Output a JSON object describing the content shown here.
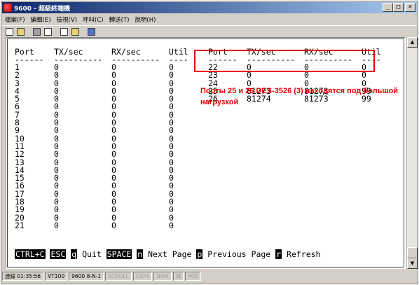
{
  "window": {
    "title": "9600 - 超級終端機"
  },
  "menu": [
    "檔案(F)",
    "編輯(E)",
    "檢視(V)",
    "呼叫(C)",
    "轉送(T)",
    "說明(H)"
  ],
  "toolbar": [
    "new-icon",
    "open-icon",
    "disconnect-icon",
    "connect-icon",
    "send-icon",
    "receive-icon",
    "properties-icon"
  ],
  "terminal": {
    "headers": {
      "port": "Port",
      "tx": "TX/sec",
      "rx": "RX/sec",
      "util": "Util",
      "port2": "Port",
      "tx2": "TX/sec",
      "rx2": "RX/sec",
      "util2": "Util"
    },
    "dashes": {
      "port": "------",
      "tx": "----------",
      "rx": "----------",
      "util": "----",
      "port2": "------",
      "tx2": "----------",
      "rx2": "----------",
      "util2": "----"
    },
    "left_ports": [
      {
        "port": "1",
        "tx": "0",
        "rx": "0",
        "util": "0"
      },
      {
        "port": "2",
        "tx": "0",
        "rx": "0",
        "util": "0"
      },
      {
        "port": "3",
        "tx": "0",
        "rx": "0",
        "util": "0"
      },
      {
        "port": "4",
        "tx": "0",
        "rx": "0",
        "util": "0"
      },
      {
        "port": "5",
        "tx": "0",
        "rx": "0",
        "util": "0"
      },
      {
        "port": "6",
        "tx": "0",
        "rx": "0",
        "util": "0"
      },
      {
        "port": "7",
        "tx": "0",
        "rx": "0",
        "util": "0"
      },
      {
        "port": "8",
        "tx": "0",
        "rx": "0",
        "util": "0"
      },
      {
        "port": "9",
        "tx": "0",
        "rx": "0",
        "util": "0"
      },
      {
        "port": "10",
        "tx": "0",
        "rx": "0",
        "util": "0"
      },
      {
        "port": "11",
        "tx": "0",
        "rx": "0",
        "util": "0"
      },
      {
        "port": "12",
        "tx": "0",
        "rx": "0",
        "util": "0"
      },
      {
        "port": "13",
        "tx": "0",
        "rx": "0",
        "util": "0"
      },
      {
        "port": "14",
        "tx": "0",
        "rx": "0",
        "util": "0"
      },
      {
        "port": "15",
        "tx": "0",
        "rx": "0",
        "util": "0"
      },
      {
        "port": "16",
        "tx": "0",
        "rx": "0",
        "util": "0"
      },
      {
        "port": "17",
        "tx": "0",
        "rx": "0",
        "util": "0"
      },
      {
        "port": "18",
        "tx": "0",
        "rx": "0",
        "util": "0"
      },
      {
        "port": "19",
        "tx": "0",
        "rx": "0",
        "util": "0"
      },
      {
        "port": "20",
        "tx": "0",
        "rx": "0",
        "util": "0"
      },
      {
        "port": "21",
        "tx": "0",
        "rx": "0",
        "util": "0"
      }
    ],
    "right_ports": [
      {
        "port": "22",
        "tx": "0",
        "rx": "0",
        "util": "0"
      },
      {
        "port": "23",
        "tx": "0",
        "rx": "0",
        "util": "0"
      },
      {
        "port": "24",
        "tx": "0",
        "rx": "0",
        "util": "0"
      },
      {
        "port": "25",
        "tx": "81273",
        "rx": "81273",
        "util": "99"
      },
      {
        "port": "26",
        "tx": "81274",
        "rx": "81273",
        "util": "99"
      }
    ],
    "annotation": "Порты 25 и 26 DES-3526 (3) находятся под большой нагрузкой",
    "annotation_color": "#e60000",
    "keys": {
      "ctrl_c": "CTRL+C",
      "esc": "ESC",
      "q": "q",
      "quit": " Quit ",
      "space": "SPACE",
      "n": "n",
      "next": " Next Page ",
      "p": "p",
      "prev": " Previous Page ",
      "r": "r",
      "refresh": " Refresh"
    }
  },
  "status": {
    "connected": "連線 01:35:56",
    "emulation": "VT100",
    "settings": "9600 8-N-1",
    "scroll": "SCROLL",
    "caps": "CAPS",
    "num": "NUM",
    "capture": "擷",
    "print": "列印"
  }
}
